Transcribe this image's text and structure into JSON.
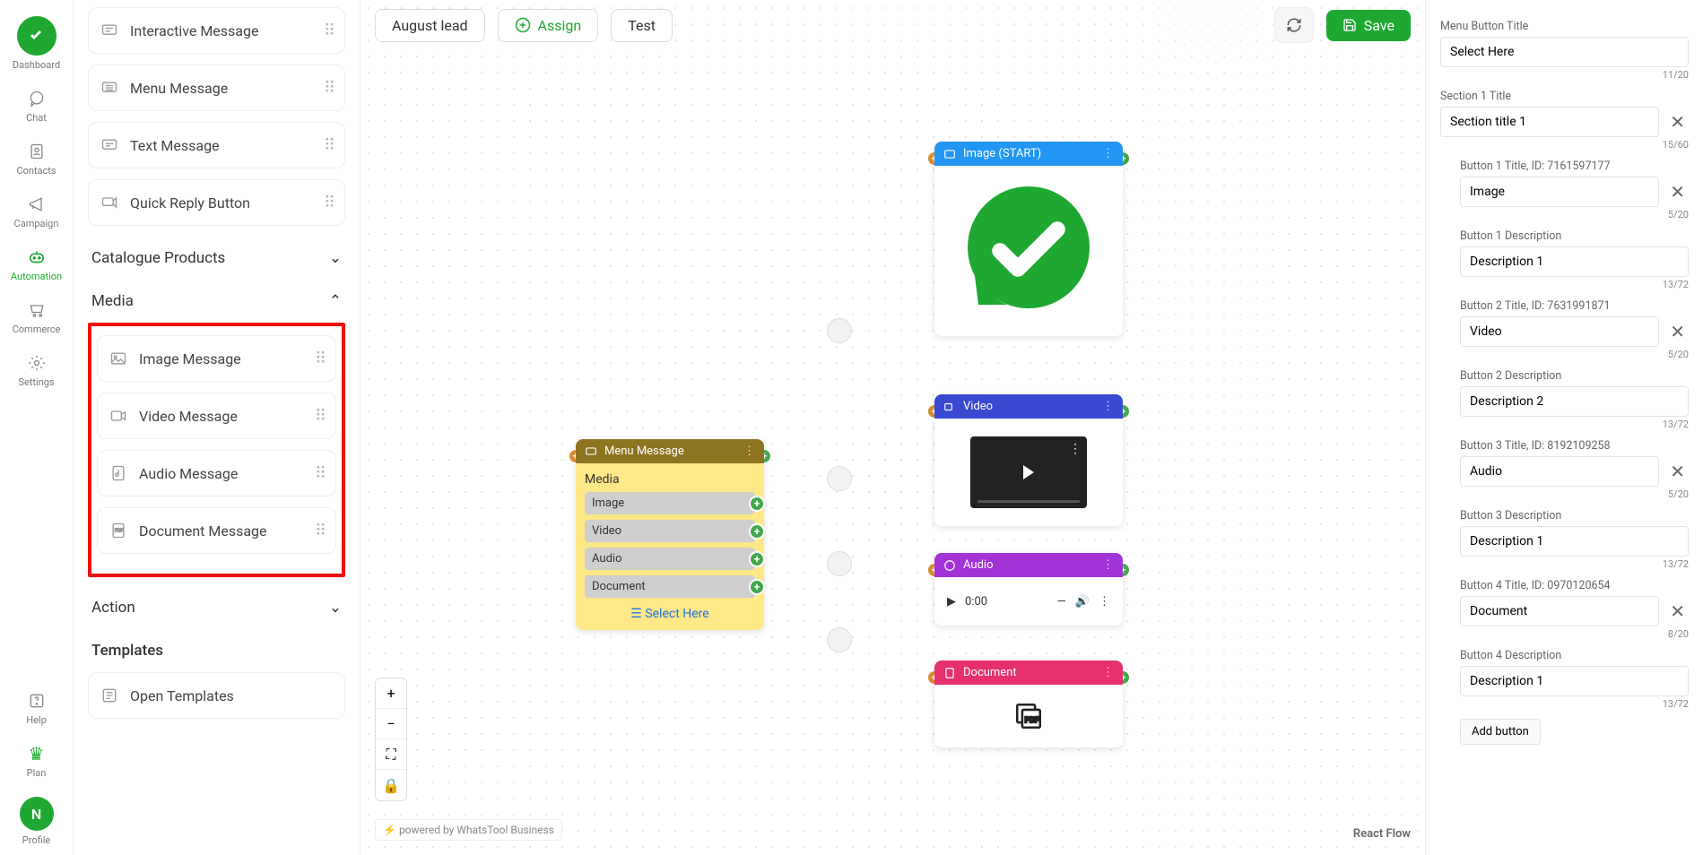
{
  "nav": {
    "items": [
      {
        "label": "Dashboard",
        "icon": "logo"
      },
      {
        "label": "Chat",
        "icon": "chat"
      },
      {
        "label": "Contacts",
        "icon": "contacts"
      },
      {
        "label": "Campaign",
        "icon": "campaign"
      },
      {
        "label": "Automation",
        "icon": "bot",
        "active": true
      },
      {
        "label": "Commerce",
        "icon": "cart"
      },
      {
        "label": "Settings",
        "icon": "gear"
      }
    ],
    "bottom": [
      {
        "label": "Help",
        "icon": "help"
      },
      {
        "label": "Plan",
        "icon": "crown"
      },
      {
        "label": "Profile",
        "icon": "avatar"
      }
    ],
    "avatar_letter": "N"
  },
  "blocks": {
    "messaging": [
      {
        "label": "Interactive Message",
        "icon": "interactive"
      },
      {
        "label": "Menu Message",
        "icon": "menu"
      },
      {
        "label": "Text Message",
        "icon": "text"
      },
      {
        "label": "Quick Reply Button",
        "icon": "reply"
      }
    ],
    "sections": [
      {
        "label": "Catalogue Products",
        "open": false
      },
      {
        "label": "Media",
        "open": true
      },
      {
        "label": "Action",
        "open": false
      }
    ],
    "media": [
      {
        "label": "Image Message",
        "icon": "image"
      },
      {
        "label": "Video Message",
        "icon": "video"
      },
      {
        "label": "Audio Message",
        "icon": "audio"
      },
      {
        "label": "Document Message",
        "icon": "doc"
      }
    ],
    "templates_head": "Templates",
    "templates_item": "Open Templates"
  },
  "topbar": {
    "name": "August lead",
    "assign": "Assign",
    "test": "Test",
    "save": "Save"
  },
  "canvas": {
    "menu_node": {
      "title": "Menu Message",
      "category": "Media",
      "rows": [
        "Image",
        "Video",
        "Audio",
        "Document"
      ],
      "footer": "Select Here"
    },
    "image_node": {
      "title": "Image (START)"
    },
    "video_node": {
      "title": "Video"
    },
    "audio_node": {
      "title": "Audio",
      "time": "0:00"
    },
    "doc_node": {
      "title": "Document"
    },
    "powered": "powered by WhatsTool Business",
    "rf": "React Flow"
  },
  "panel": {
    "menu_title_label": "Menu Button Title",
    "menu_title_value": "Select Here",
    "menu_title_count": "11/20",
    "section_label": "Section 1 Title",
    "section_value": "Section title 1",
    "section_count": "15/60",
    "buttons": [
      {
        "tl": "Button 1 Title, ID: 7161597177",
        "tv": "Image",
        "tc": "5/20",
        "dl": "Button 1 Description",
        "dv": "Description 1",
        "dc": "13/72"
      },
      {
        "tl": "Button 2 Title, ID: 7631991871",
        "tv": "Video",
        "tc": "5/20",
        "dl": "Button 2 Description",
        "dv": "Description 2",
        "dc": "13/72"
      },
      {
        "tl": "Button 3 Title, ID: 8192109258",
        "tv": "Audio",
        "tc": "5/20",
        "dl": "Button 3 Description",
        "dv": "Description 1",
        "dc": "13/72"
      },
      {
        "tl": "Button 4 Title, ID: 0970120654",
        "tv": "Document",
        "tc": "8/20",
        "dl": "Button 4 Description",
        "dv": "Description 1",
        "dc": "13/72"
      }
    ],
    "add": "Add button"
  }
}
